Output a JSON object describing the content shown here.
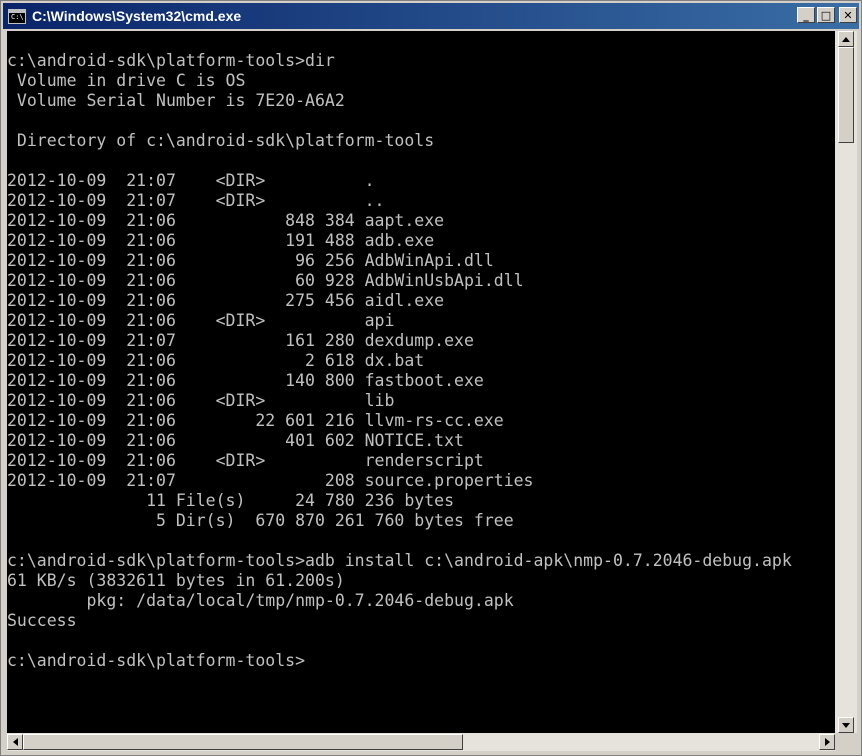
{
  "window": {
    "title": "C:\\Windows\\System32\\cmd.exe",
    "app_icon_glyph": "C:\\"
  },
  "controls": {
    "minimize": "_",
    "maximize": "□",
    "close": "✕"
  },
  "console": {
    "lines": [
      "c:\\android-sdk\\platform-tools>dir",
      " Volume in drive C is OS",
      " Volume Serial Number is 7E20-A6A2",
      "",
      " Directory of c:\\android-sdk\\platform-tools",
      "",
      "2012-10-09  21:07    <DIR>          .",
      "2012-10-09  21:07    <DIR>          ..",
      "2012-10-09  21:06           848 384 aapt.exe",
      "2012-10-09  21:06           191 488 adb.exe",
      "2012-10-09  21:06            96 256 AdbWinApi.dll",
      "2012-10-09  21:06            60 928 AdbWinUsbApi.dll",
      "2012-10-09  21:06           275 456 aidl.exe",
      "2012-10-09  21:06    <DIR>          api",
      "2012-10-09  21:07           161 280 dexdump.exe",
      "2012-10-09  21:06             2 618 dx.bat",
      "2012-10-09  21:06           140 800 fastboot.exe",
      "2012-10-09  21:06    <DIR>          lib",
      "2012-10-09  21:06        22 601 216 llvm-rs-cc.exe",
      "2012-10-09  21:06           401 602 NOTICE.txt",
      "2012-10-09  21:06    <DIR>          renderscript",
      "2012-10-09  21:07               208 source.properties",
      "              11 File(s)     24 780 236 bytes",
      "               5 Dir(s)  670 870 261 760 bytes free",
      "",
      "c:\\android-sdk\\platform-tools>adb install c:\\android-apk\\nmp-0.7.2046-debug.apk",
      "61 KB/s (3832611 bytes in 61.200s)",
      "        pkg: /data/local/tmp/nmp-0.7.2046-debug.apk",
      "Success",
      "",
      "c:\\android-sdk\\platform-tools>"
    ]
  },
  "colors": {
    "console_bg": "#000000",
    "console_fg": "#c0c0c0",
    "titlebar_start": "#0a246a",
    "titlebar_end": "#3a6ea5"
  }
}
